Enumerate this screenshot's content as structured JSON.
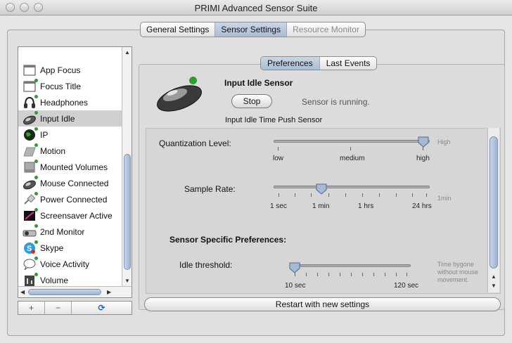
{
  "window": {
    "title": "PRIMI Advanced Sensor Suite"
  },
  "main_tabs": [
    {
      "label": "General Settings"
    },
    {
      "label": "Sensor Settings"
    },
    {
      "label": "Resource Monitor"
    }
  ],
  "sensors": [
    {
      "label": "App Focus",
      "icon": "window-icon"
    },
    {
      "label": "Focus Title",
      "icon": "window-icon"
    },
    {
      "label": "Headphones",
      "icon": "headphones-icon"
    },
    {
      "label": "Input Idle",
      "icon": "mouse-icon"
    },
    {
      "label": "IP",
      "icon": "globe-icon"
    },
    {
      "label": "Motion",
      "icon": "motion-icon"
    },
    {
      "label": "Mounted Volumes",
      "icon": "disk-icon"
    },
    {
      "label": "Mouse Connected",
      "icon": "mouse-icon"
    },
    {
      "label": "Power Connected",
      "icon": "power-plug-icon"
    },
    {
      "label": "Screensaver Active",
      "icon": "screensaver-icon"
    },
    {
      "label": "2nd Monitor",
      "icon": "projector-icon"
    },
    {
      "label": "Skype",
      "icon": "skype-icon"
    },
    {
      "label": "Voice Activity",
      "icon": "speech-bubble-icon"
    },
    {
      "label": "Volume",
      "icon": "volume-icon"
    }
  ],
  "list_buttons": {
    "add": "+",
    "remove": "−",
    "refresh": "⟳"
  },
  "sub_tabs": [
    {
      "label": "Preferences"
    },
    {
      "label": "Last Events"
    }
  ],
  "sensor": {
    "name": "Input Idle Sensor",
    "stop_label": "Stop",
    "status": "Sensor is running.",
    "description": "Input Idle Time Push Sensor"
  },
  "quantization": {
    "label": "Quantization Level:",
    "ticks": [
      "low",
      "medium",
      "high"
    ],
    "value": "high",
    "hint": "High"
  },
  "sample_rate": {
    "label": "Sample Rate:",
    "ticks": [
      "1 sec",
      "1 min",
      "1 hrs",
      "24 hrs"
    ],
    "value": "1 min",
    "hint": "1min"
  },
  "specific": {
    "heading": "Sensor Specific Preferences:",
    "idle_label": "Idle threshold:",
    "idle_ticks": [
      "10 sec",
      "120 sec"
    ],
    "idle_value": "10 sec",
    "idle_hint_1": "Time bygone",
    "idle_hint_2": "without mouse",
    "idle_hint_3": "movement."
  },
  "restart_label": "Restart with new settings",
  "colors": {
    "accent": "#aabdd3",
    "status_dot": "#2f9e2f"
  }
}
